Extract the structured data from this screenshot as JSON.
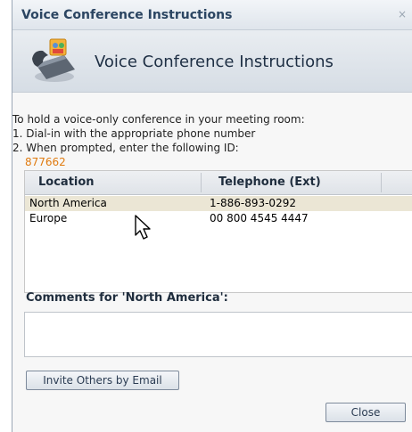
{
  "window": {
    "title": "Voice Conference Instructions",
    "close_glyph": "×"
  },
  "header": {
    "title": "Voice Conference Instructions",
    "icon": "phone-icon"
  },
  "instructions": {
    "intro": "To hold a voice-only conference in your meeting room:",
    "step1": "1.  Dial-in with the appropriate phone number",
    "step2": "2.  When prompted, enter the following ID:",
    "conference_id": "877662"
  },
  "table": {
    "columns": [
      "Location",
      "Telephone (Ext)"
    ],
    "rows": [
      {
        "location": "North America",
        "telephone": "1-886-893-0292",
        "selected": true
      },
      {
        "location": "Europe",
        "telephone": "00 800 4545 4447",
        "selected": false
      }
    ]
  },
  "comments": {
    "label": "Comments for 'North America':",
    "value": ""
  },
  "buttons": {
    "invite": "Invite Others by Email",
    "close": "Close"
  },
  "colors": {
    "accent_id": "#e07b10",
    "selected_row": "#ebe6d5",
    "title_text": "#2b4562"
  }
}
